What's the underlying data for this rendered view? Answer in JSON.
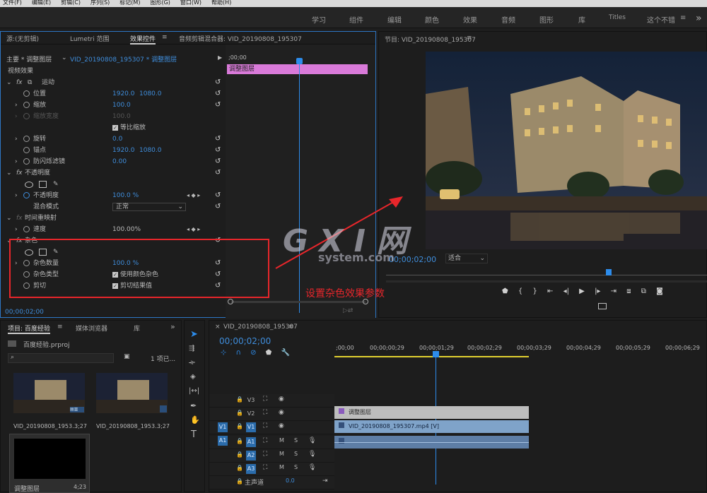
{
  "menu": [
    "文件(F)",
    "编辑(E)",
    "剪辑(C)",
    "序列(S)",
    "标记(M)",
    "图形(G)",
    "窗口(W)",
    "帮助(H)"
  ],
  "workspaces": [
    "学习",
    "组件",
    "编辑",
    "颜色",
    "效果",
    "音频",
    "图形",
    "库",
    "Titles",
    "这个不错"
  ],
  "source_panel": {
    "tabs": [
      "源:(无剪辑)",
      "Lumetri 范围",
      "效果控件",
      "音频剪辑混合器: VID_20190808_195307"
    ],
    "master_label": "主要 * 调整图层",
    "clip_label": "VID_20190808_195307 * 调整图层",
    "timeline_start": ";00;00",
    "clip_bar_label": "调整图层",
    "section_video": "视频效果",
    "motion": "运动",
    "position": {
      "label": "位置",
      "x": "1920.0",
      "y": "1080.0"
    },
    "scale": {
      "label": "缩放",
      "value": "100.0"
    },
    "scale_width": {
      "label": "缩放宽度",
      "value": "100.0"
    },
    "uniform_scale": "等比缩放",
    "rotation": {
      "label": "旋转",
      "value": "0.0"
    },
    "anchor": {
      "label": "锚点",
      "x": "1920.0",
      "y": "1080.0"
    },
    "flicker": {
      "label": "防闪烁滤镜",
      "value": "0.00"
    },
    "opacity_section": "不透明度",
    "opacity": {
      "label": "不透明度",
      "value": "100.0 %"
    },
    "blend": {
      "label": "混合模式",
      "value": "正常"
    },
    "time_remap": "时间重映射",
    "speed": {
      "label": "速度",
      "value": "100.00%"
    },
    "noise_section": "杂色",
    "noise_amount": {
      "label": "杂色数量",
      "value": "100.0 %"
    },
    "noise_type": {
      "label": "杂色类型",
      "value": "使用颜色杂色"
    },
    "clip": {
      "label": "剪切",
      "value": "剪切结果值"
    },
    "timecode": "00;00;02;00"
  },
  "program_panel": {
    "title": "节目: VID_20190808_195307",
    "timecode": "00;00;02;00",
    "fit": "适合"
  },
  "annotation": {
    "text": "设置杂色效果参数"
  },
  "watermark": {
    "main": "G X I 网",
    "sub": "system.com"
  },
  "project_panel": {
    "tabs": [
      "项目: 百度经验",
      "媒体浏览器",
      "库"
    ],
    "file": "百度经验.prproj",
    "count": "1 项已...",
    "items": [
      {
        "name": "VID_20190808_1953...",
        "dur": "3;27"
      },
      {
        "name": "VID_20190808_1953...",
        "dur": "3;27"
      },
      {
        "name": "调整图层",
        "dur": "4;23"
      }
    ]
  },
  "timeline": {
    "tab": "VID_20190808_195307",
    "timecode": "00;00;02;00",
    "ruler": [
      ";00;00",
      "00;00;00;29",
      "00;00;01;29",
      "00;00;02;29",
      "00;00;03;29",
      "00;00;04;29",
      "00;00;05;29",
      "00;00;06;29"
    ],
    "video_tracks": [
      "V3",
      "V2",
      "V1"
    ],
    "audio_tracks": [
      "A1",
      "A2",
      "A3"
    ],
    "v1_src": "V1",
    "a1_src": "A1",
    "master": "主声道",
    "master_val": "0.0",
    "clip_adjust": "调整图层",
    "clip_video": "VID_20190808_195307.mp4 [V]"
  },
  "colors": {
    "accent": "#2d8ceb",
    "clip_pink": "#d97ad9",
    "clip_blue": "#7fa3c9",
    "annotation": "#e8262b"
  }
}
